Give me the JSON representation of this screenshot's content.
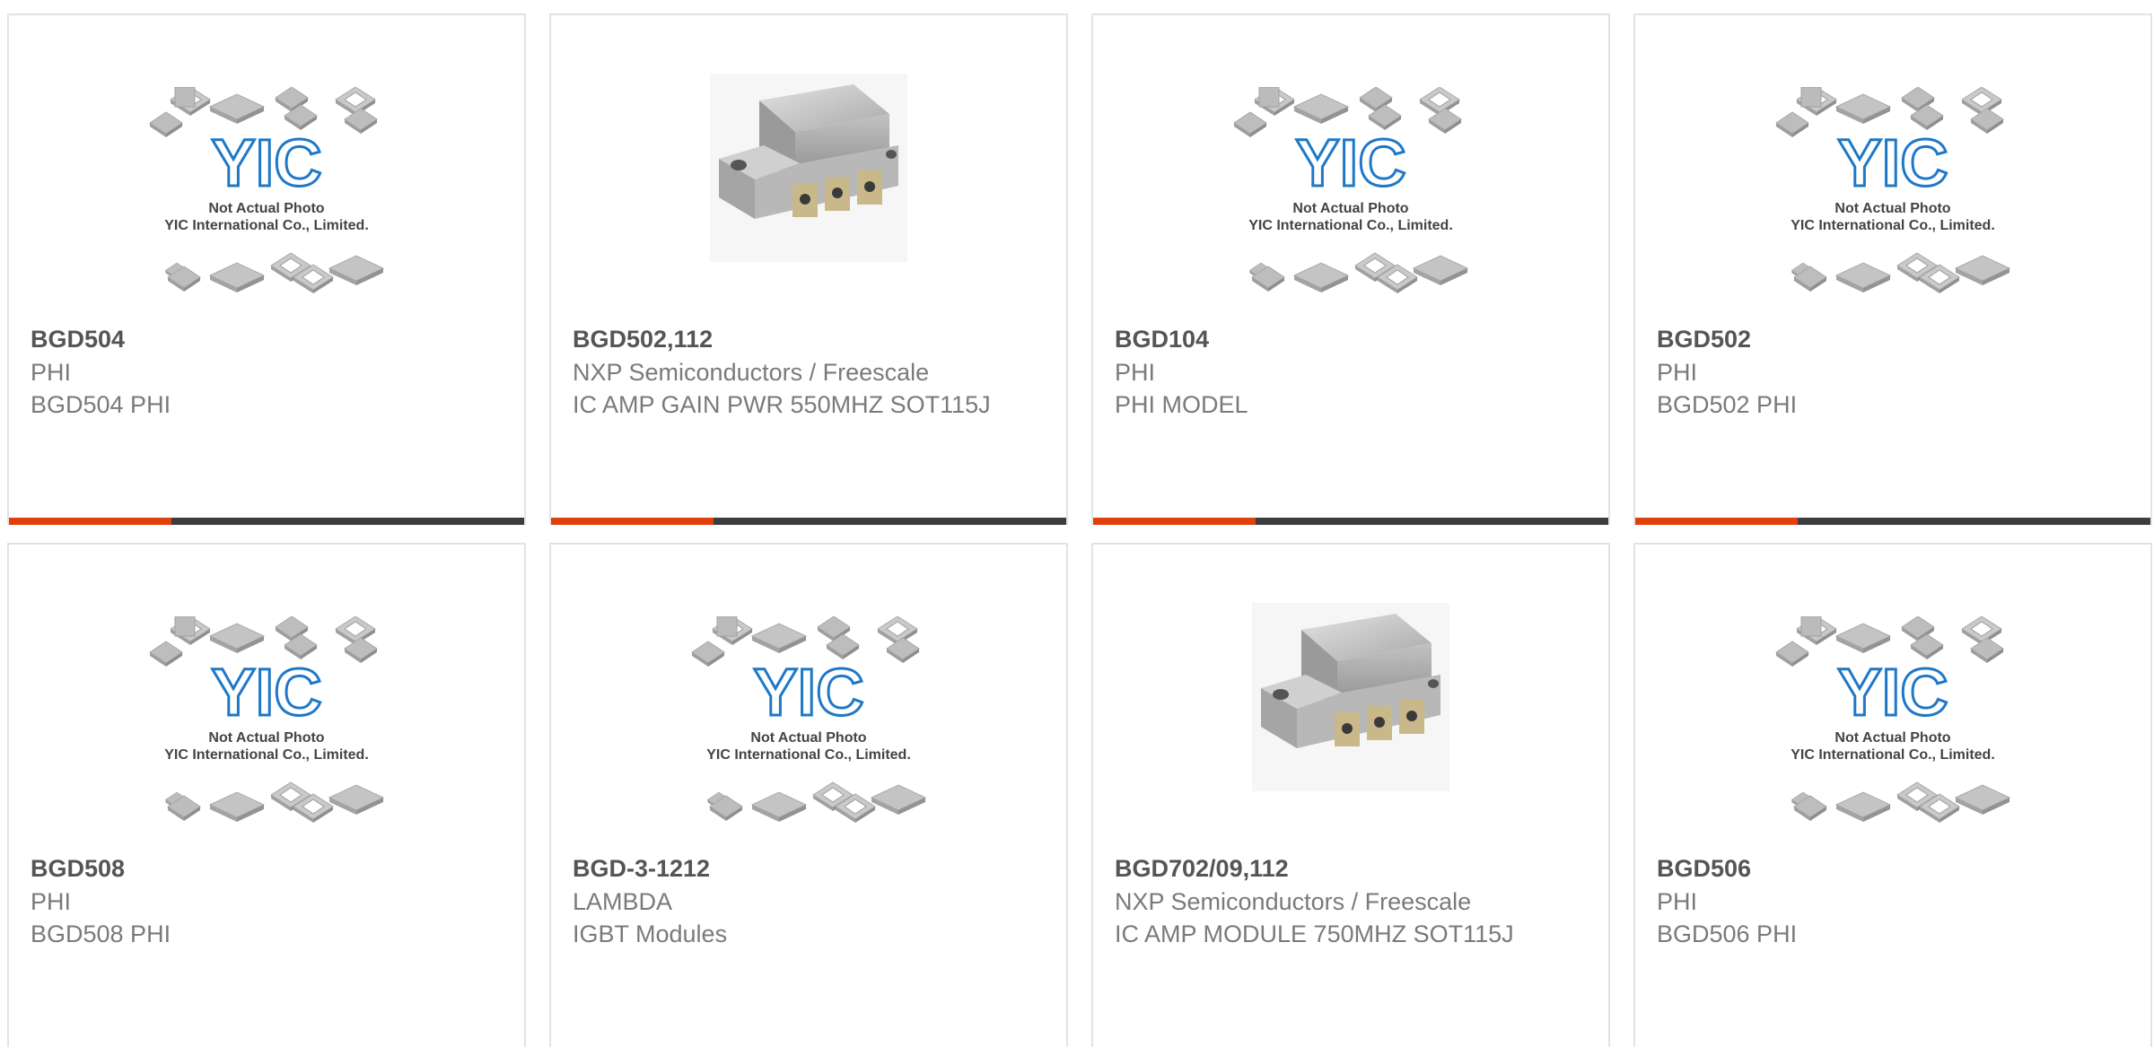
{
  "colors": {
    "accent": "#e0400c",
    "bar_dark": "#3d3d3d",
    "part_number": "#555555",
    "text": "#7a7a7a",
    "logo_blue": "#1e78c8"
  },
  "placeholder": {
    "logo": "YIC",
    "line1": "Not Actual Photo",
    "line2": "YIC International Co., Limited."
  },
  "products": [
    {
      "part": "BGD504",
      "mfr": "PHI",
      "desc": "BGD504 PHI",
      "image": "placeholder"
    },
    {
      "part": "BGD502,112",
      "mfr": "NXP Semiconductors / Freescale",
      "desc": "IC AMP GAIN PWR 550MHZ SOT115J",
      "image": "module-photo"
    },
    {
      "part": "BGD104",
      "mfr": "PHI",
      "desc": "PHI MODEL",
      "image": "placeholder"
    },
    {
      "part": "BGD502",
      "mfr": "PHI",
      "desc": "BGD502 PHI",
      "image": "placeholder"
    },
    {
      "part": "BGD508",
      "mfr": "PHI",
      "desc": "BGD508 PHI",
      "image": "placeholder"
    },
    {
      "part": "BGD-3-1212",
      "mfr": "LAMBDA",
      "desc": "IGBT Modules",
      "image": "placeholder"
    },
    {
      "part": "BGD702/09,112",
      "mfr": "NXP Semiconductors / Freescale",
      "desc": "IC AMP MODULE 750MHZ SOT115J",
      "image": "module-photo"
    },
    {
      "part": "BGD506",
      "mfr": "PHI",
      "desc": "BGD506 PHI",
      "image": "placeholder"
    }
  ]
}
